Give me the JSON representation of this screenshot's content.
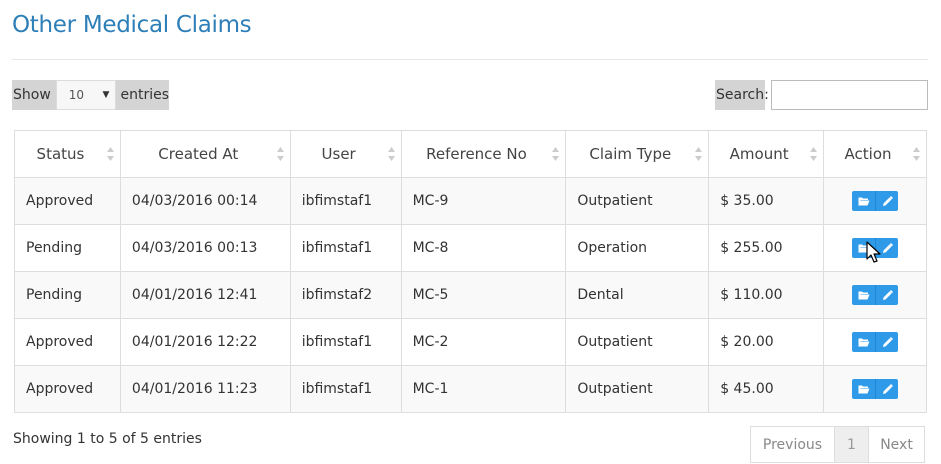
{
  "page": {
    "title": "Other Medical Claims"
  },
  "controls": {
    "show_label": "Show",
    "entries_label": "entries",
    "page_length_value": "10",
    "search_label": "Search:",
    "search_value": ""
  },
  "table": {
    "columns": [
      "Status",
      "Created At",
      "User",
      "Reference No",
      "Claim Type",
      "Amount",
      "Action"
    ],
    "rows": [
      {
        "status": "Approved",
        "created_at": "04/03/2016 00:14",
        "user": "ibfimstaf1",
        "reference_no": "MC-9",
        "claim_type": "Outpatient",
        "amount": "$ 35.00"
      },
      {
        "status": "Pending",
        "created_at": "04/03/2016 00:13",
        "user": "ibfimstaf1",
        "reference_no": "MC-8",
        "claim_type": "Operation",
        "amount": "$ 255.00"
      },
      {
        "status": "Pending",
        "created_at": "04/01/2016 12:41",
        "user": "ibfimstaf2",
        "reference_no": "MC-5",
        "claim_type": "Dental",
        "amount": "$ 110.00"
      },
      {
        "status": "Approved",
        "created_at": "04/01/2016 12:22",
        "user": "ibfimstaf1",
        "reference_no": "MC-2",
        "claim_type": "Outpatient",
        "amount": "$ 20.00"
      },
      {
        "status": "Approved",
        "created_at": "04/01/2016 11:23",
        "user": "ibfimstaf1",
        "reference_no": "MC-1",
        "claim_type": "Outpatient",
        "amount": "$ 45.00"
      }
    ],
    "row_actions": [
      "folder-open-icon",
      "pencil-icon"
    ]
  },
  "footer": {
    "info": "Showing 1 to 5 of 5 entries",
    "prev_label": "Previous",
    "current_page": "1",
    "next_label": "Next"
  },
  "colors": {
    "title": "#2e7fb8",
    "action_button": "#2f9ae8",
    "control_bg": "#d4d4d4"
  }
}
